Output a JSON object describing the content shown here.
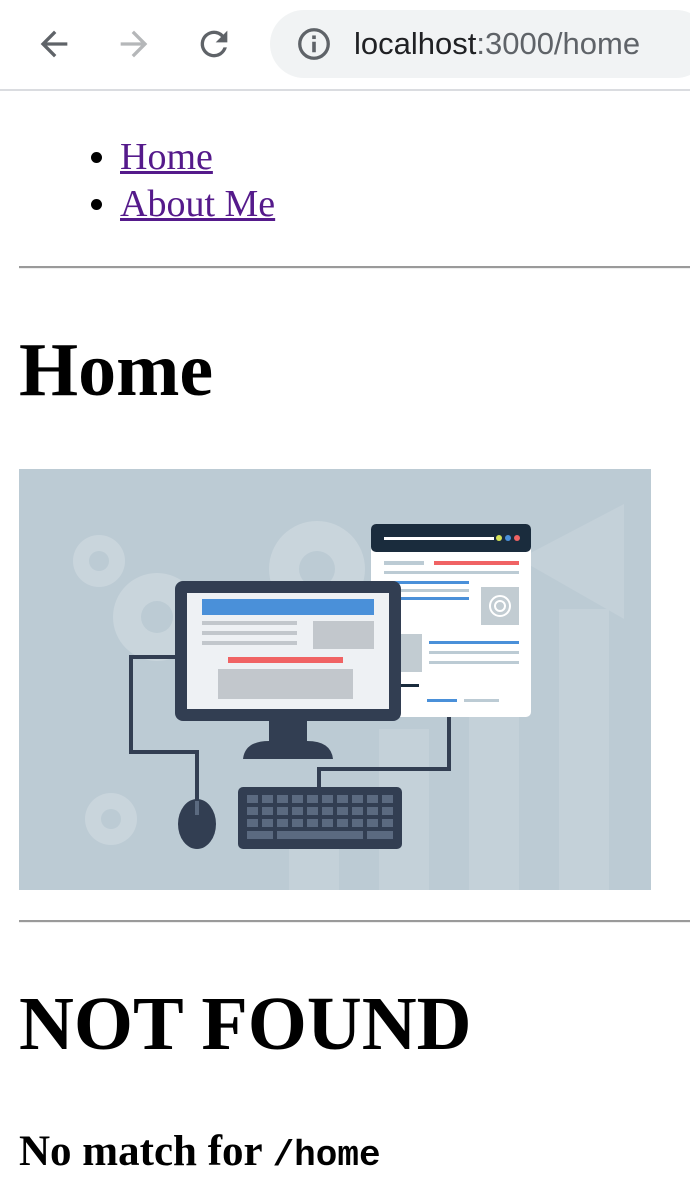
{
  "browser": {
    "url_host": "localhost",
    "url_rest": ":3000/home",
    "icons": [
      "back-arrow-icon",
      "forward-arrow-icon",
      "reload-icon",
      "info-icon"
    ]
  },
  "nav": {
    "items": [
      {
        "label": "Home"
      },
      {
        "label": "About Me"
      }
    ]
  },
  "home": {
    "title": "Home",
    "image_alt": "web development illustration"
  },
  "notfound": {
    "title": "NOT FOUND",
    "message_prefix": "No match for ",
    "path": "/home"
  },
  "colors": {
    "link": "#551a8b",
    "hero_bg": "#bccbd4",
    "monitor": "#323e52",
    "accent_blue": "#4a90d9",
    "accent_red": "#f06364"
  }
}
